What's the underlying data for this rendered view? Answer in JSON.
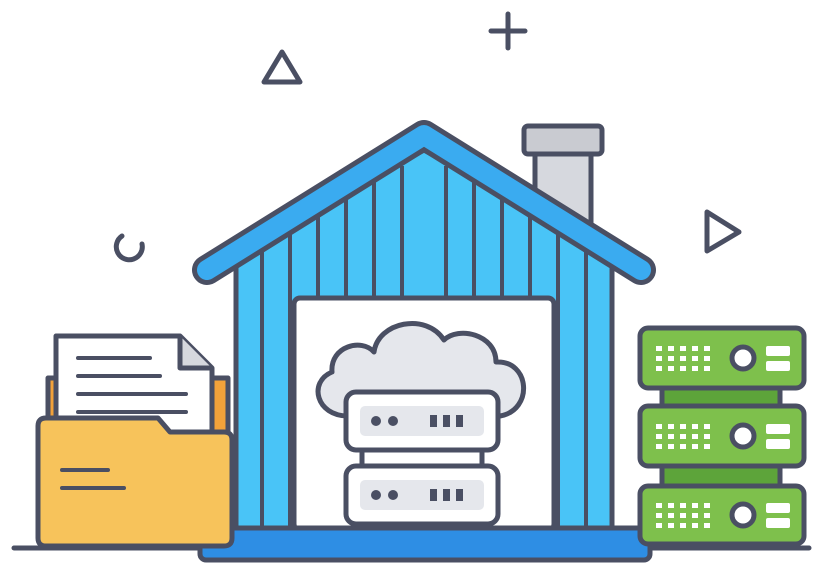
{
  "illustration": {
    "subject": "house-with-cloud-server",
    "elements": {
      "ground-line": {
        "icon": "ground-line"
      },
      "decorations": [
        "plus-icon",
        "triangle-icon",
        "play-triangle-icon",
        "ring-icon"
      ],
      "house": {
        "icon": "house-icon",
        "door_opening": "door-opening"
      },
      "cloud-server": {
        "icon": "cloud-server-icon",
        "server_units": 2
      },
      "folder": {
        "icon": "folder-with-document-icon"
      },
      "server-rack": {
        "icon": "server-rack-icon",
        "units": 3
      }
    }
  },
  "colors": {
    "outline": "#4a4f63",
    "blue": "#3aabf0",
    "blue_light": "#49c4f7",
    "blue_dark": "#2e8ee4",
    "gray_chimney": "#d6d8de",
    "gray_panel": "#c9cbd1",
    "cloud_bg": "#e5e7ec",
    "white": "#ffffff",
    "folder_yellow": "#f7c35b",
    "folder_orange": "#f2a23a",
    "green": "#7ec04c",
    "green_dark": "#5da43a",
    "document": "#ffffff"
  }
}
